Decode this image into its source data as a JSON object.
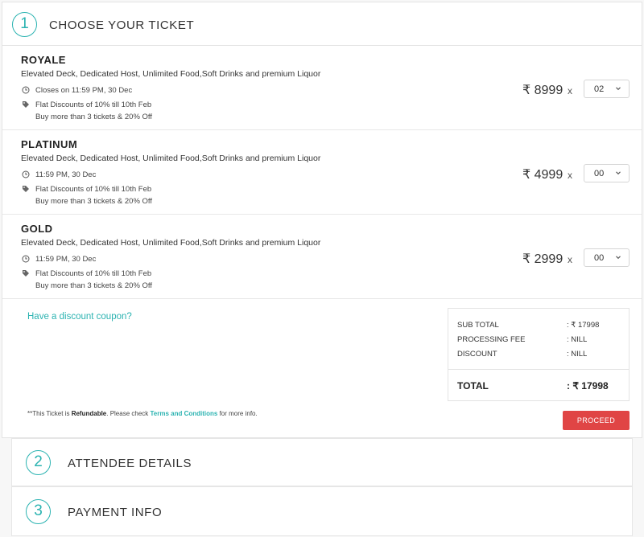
{
  "step1": {
    "number": "1",
    "title": "CHOOSE YOUR TICKET"
  },
  "tickets": [
    {
      "name": "ROYALE",
      "description": "Elevated Deck, Dedicated Host, Unlimited Food,Soft Drinks and premium Liquor",
      "closes": "Closes on 11:59 PM, 30 Dec",
      "offer": "Flat Discounts of 10% till 10th Feb",
      "offer2": "Buy more than 3 tickets & 20% Off",
      "price": "₹ 8999",
      "times": "x",
      "qty": "02"
    },
    {
      "name": "PLATINUM",
      "description": "Elevated Deck, Dedicated Host, Unlimited Food,Soft Drinks and premium Liquor",
      "closes": "11:59 PM, 30 Dec",
      "offer": "Flat Discounts of 10% till 10th Feb",
      "offer2": "Buy more than 3 tickets & 20% Off",
      "price": "₹ 4999",
      "times": "x",
      "qty": "00"
    },
    {
      "name": "GOLD",
      "description": "Elevated Deck, Dedicated Host, Unlimited Food,Soft Drinks and premium Liquor",
      "closes": "11:59 PM, 30 Dec",
      "offer": "Flat Discounts of 10% till 10th Feb",
      "offer2": "Buy more than 3 tickets & 20% Off",
      "price": "₹ 2999",
      "times": "x",
      "qty": "00"
    }
  ],
  "coupon_link": "Have a discount coupon?",
  "summary": {
    "subtotal_label": "SUB TOTAL",
    "subtotal_value": ": ₹ 17998",
    "fee_label": "PROCESSING FEE",
    "fee_value": ": NILL",
    "discount_label": "DISCOUNT",
    "discount_value": ": NILL",
    "total_label": "TOTAL",
    "total_value": ": ₹ 17998"
  },
  "refund": {
    "prefix": "**This Ticket is ",
    "bold": "Refundable",
    "middle": ". Please check ",
    "link": "Terms and Conditions",
    "suffix": " for more info."
  },
  "proceed_label": "PROCEED",
  "step2": {
    "number": "2",
    "title": "ATTENDEE DETAILS"
  },
  "step3": {
    "number": "3",
    "title": "PAYMENT INFO"
  },
  "colors": {
    "accent": "#2bb3b1",
    "proceed": "#e04545"
  }
}
